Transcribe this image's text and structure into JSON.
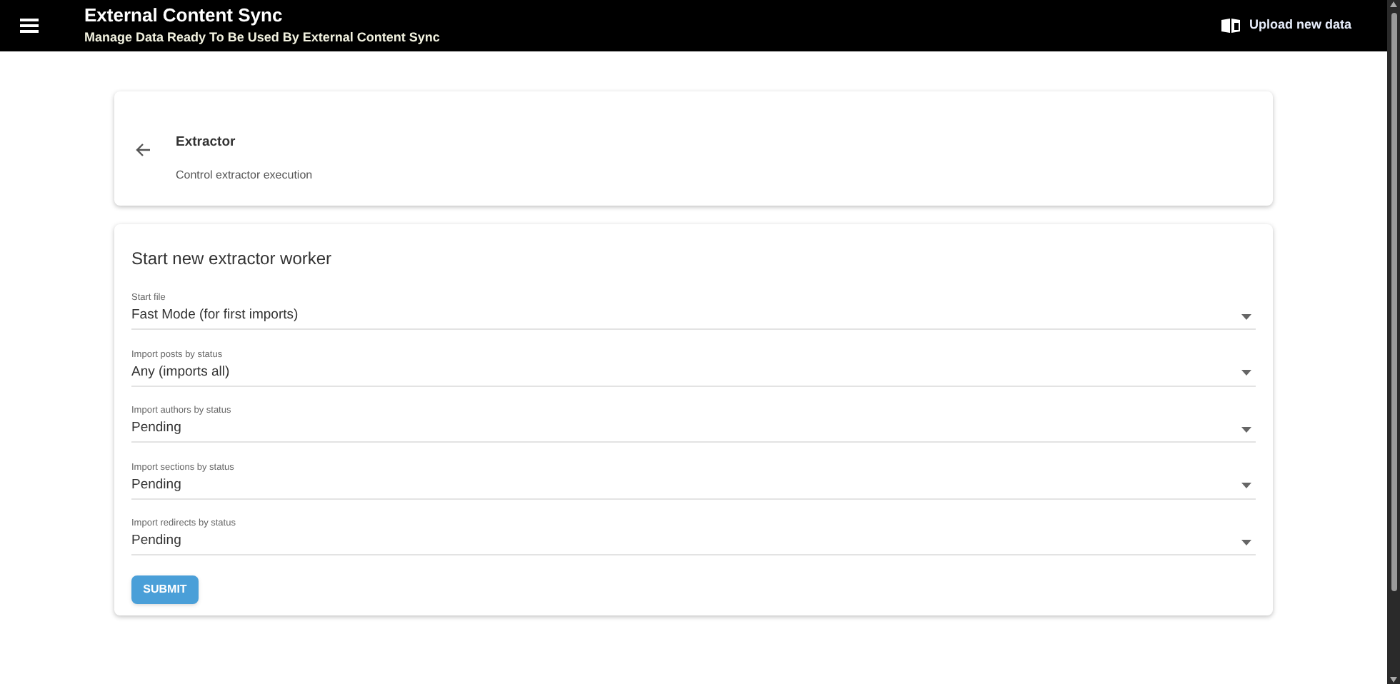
{
  "app_bar": {
    "title": "External Content Sync",
    "subtitle": "Manage Data Ready To Be Used By External Content Sync",
    "action": "Upload new data"
  },
  "header_card": {
    "title": "Extractor",
    "description": "Control extractor execution"
  },
  "form": {
    "title": "Start new extractor worker",
    "fields": [
      {
        "label": "Start file",
        "value": "Fast Mode (for first imports)"
      },
      {
        "label": "Import posts by status",
        "value": "Any (imports all)"
      },
      {
        "label": "Import authors by status",
        "value": "Pending"
      },
      {
        "label": "Import sections by status",
        "value": "Pending"
      },
      {
        "label": "Import redirects by status",
        "value": "Pending"
      }
    ],
    "submit": "SUBMIT"
  }
}
